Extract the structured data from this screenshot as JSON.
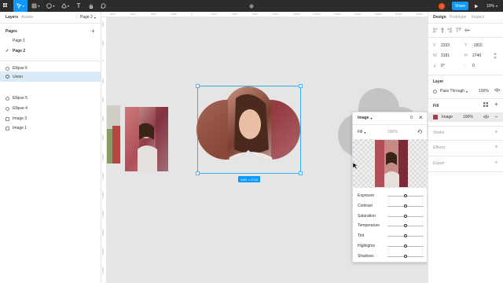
{
  "toolbar": {
    "share_label": "Share",
    "zoom_label": "10%",
    "avatar_letter": "I"
  },
  "left": {
    "tabs": {
      "layers": "Layers",
      "assets": "Assets",
      "page_selector": "Page 2"
    },
    "pages_title": "Pages",
    "add_symbol": "+",
    "pages": [
      {
        "label": "Page 1",
        "current": false
      },
      {
        "label": "Page 2",
        "current": true,
        "check": "✓"
      }
    ],
    "layers": [
      {
        "label": "Ellipse 6",
        "type": "ellipse",
        "selected": false
      },
      {
        "label": "Union",
        "type": "union",
        "selected": true
      },
      {
        "label": "Ellipse 5",
        "type": "ellipse",
        "selected": false
      },
      {
        "label": "Ellipse 4",
        "type": "ellipse",
        "selected": false
      },
      {
        "label": "Image 3",
        "type": "image",
        "selected": false
      },
      {
        "label": "Image 1",
        "type": "image",
        "selected": false
      }
    ]
  },
  "canvas": {
    "selection_size": "3181 × 2740",
    "ruler_top_marks": [
      "-8000",
      "-6000",
      "-4000",
      "-2000",
      "0",
      "2000",
      "4000",
      "6000",
      "8000",
      "10000",
      "12000",
      "14000",
      "16000",
      "18000",
      "20000",
      "22000"
    ],
    "ruler_left_marks": [
      "-4000",
      "-2000",
      "0",
      "2000",
      "4000",
      "6000",
      "8000",
      "10000",
      "12000",
      "14000",
      "16000",
      "18000",
      "20000",
      "22000"
    ]
  },
  "image_popup": {
    "title": "Image",
    "zero_label": "0",
    "fill_mode": "Fill",
    "opacity": "100%",
    "adjustments": [
      {
        "label": "Exposure",
        "value": 0.5
      },
      {
        "label": "Contrast",
        "value": 0.5
      },
      {
        "label": "Saturation",
        "value": 0.5
      },
      {
        "label": "Temperature",
        "value": 0.5
      },
      {
        "label": "Tint",
        "value": 0.5
      },
      {
        "label": "Highlights",
        "value": 0.5
      },
      {
        "label": "Shadows",
        "value": 0.5
      }
    ]
  },
  "right": {
    "tabs": {
      "design": "Design",
      "prototype": "Prototype",
      "inspect": "Inspect"
    },
    "x": "2333",
    "y": "-1815",
    "w": "3181",
    "h": "2740",
    "rotation": "0°",
    "radius": "0",
    "layer_title": "Layer",
    "blend_mode": "Pass Through",
    "layer_opacity": "100%",
    "fill_title": "Fill",
    "fill_type": "Image",
    "fill_opacity": "100%",
    "stroke_title": "Stroke",
    "effects_title": "Effects",
    "export_title": "Export",
    "plus": "+",
    "minus": "−"
  },
  "colors": {
    "accent": "#0d99ff",
    "topbar": "#2c2c2c",
    "canvas": "#e5e5e5",
    "selected_row": "#daebf7",
    "avatar": "#f24e1e",
    "gray_shape": "#c4c4c4"
  }
}
